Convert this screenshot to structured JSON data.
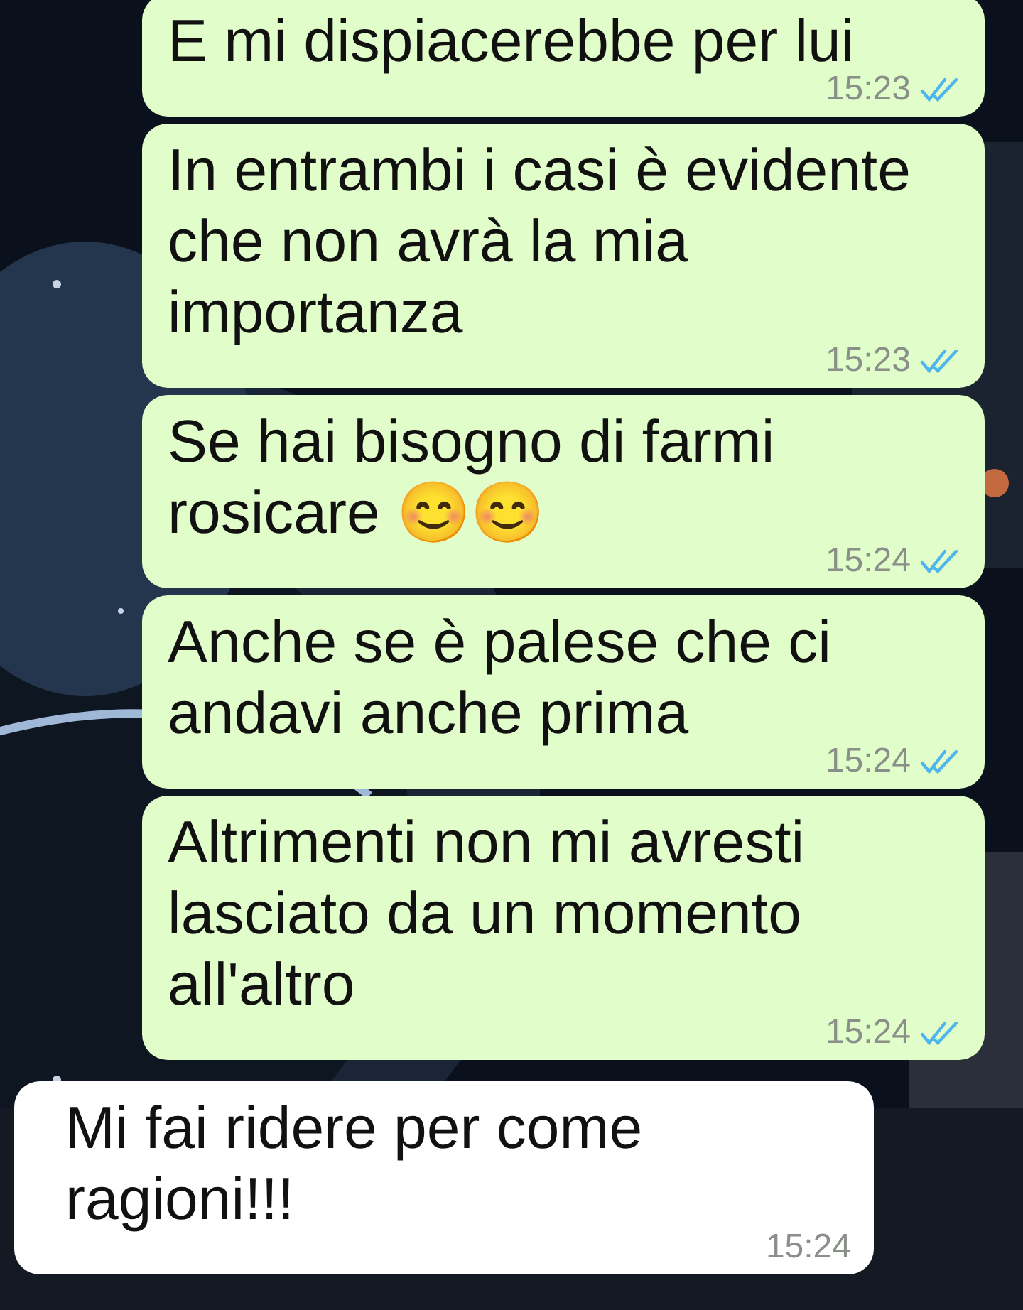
{
  "messages": [
    {
      "kind": "sent",
      "text": "E mi dispiacerebbe per lui",
      "time": "15:23",
      "read": true
    },
    {
      "kind": "sent",
      "text": "In entrambi i casi è evidente che non avrà la mia importanza",
      "time": "15:23",
      "read": true
    },
    {
      "kind": "sent",
      "text": "Se hai bisogno di farmi rosicare 😊😊",
      "time": "15:24",
      "read": true
    },
    {
      "kind": "sent",
      "text": "Anche se è palese che ci andavi anche prima",
      "time": "15:24",
      "read": true
    },
    {
      "kind": "sent",
      "text": "Altrimenti non mi avresti lasciato da un momento all'altro",
      "time": "15:24",
      "read": true
    },
    {
      "kind": "received",
      "text": "Mi fai ridere per come ragioni!!!",
      "time": "15:24"
    }
  ]
}
